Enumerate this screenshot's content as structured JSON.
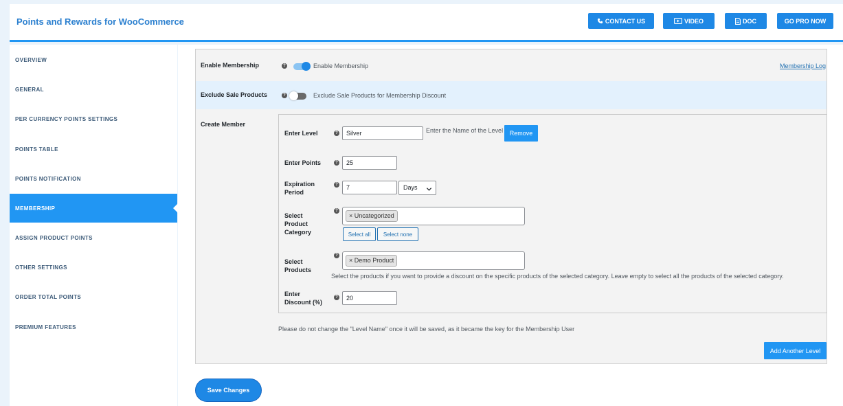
{
  "app": {
    "title": "Points and Rewards for WooCommerce"
  },
  "header_buttons": [
    {
      "label": "CONTACT US",
      "icon": "phone-icon"
    },
    {
      "label": "VIDEO",
      "icon": "play-icon"
    },
    {
      "label": "DOC",
      "icon": "document-icon"
    },
    {
      "label": "GO PRO NOW",
      "icon": ""
    }
  ],
  "sidebar": {
    "items": [
      {
        "label": "OVERVIEW",
        "active": false
      },
      {
        "label": "GENERAL",
        "active": false
      },
      {
        "label": "PER CURRENCY POINTS SETTINGS",
        "active": false
      },
      {
        "label": "POINTS TABLE",
        "active": false
      },
      {
        "label": "POINTS NOTIFICATION",
        "active": false
      },
      {
        "label": "MEMBERSHIP",
        "active": true
      },
      {
        "label": "ASSIGN PRODUCT POINTS",
        "active": false
      },
      {
        "label": "OTHER SETTINGS",
        "active": false
      },
      {
        "label": "ORDER TOTAL POINTS",
        "active": false
      },
      {
        "label": "PREMIUM FEATURES",
        "active": false
      }
    ]
  },
  "settings": {
    "enable_membership": {
      "label": "Enable Membership",
      "toggle_on": true,
      "description": "Enable Membership",
      "log_link": "Membership Log"
    },
    "exclude_sale": {
      "label": "Exclude Sale Products",
      "toggle_on": false,
      "description": "Exclude Sale Products for Membership Discount"
    },
    "create_member": {
      "label": "Create Member",
      "level": {
        "label": "Enter Level",
        "value": "Silver",
        "hint": "Enter the Name of the Level",
        "remove_label": "Remove"
      },
      "points": {
        "label": "Enter Points",
        "value": "25"
      },
      "expiration": {
        "label": "Expiration Period",
        "value": "7",
        "unit": "Days"
      },
      "category": {
        "label": "Select Product Category",
        "chips": [
          "× Uncategorized"
        ],
        "select_all": "Select all",
        "select_none": "Select none"
      },
      "products": {
        "label": "Select Products",
        "chips": [
          "× Demo Product"
        ],
        "hint": "Select the products if you want to provide a discount on the specific products of the selected category. Leave empty to select all the products of the selected category."
      },
      "discount": {
        "label": "Enter Discount (%)",
        "value": "20"
      },
      "notice": "Please do not change the \"Level Name\" once it will be saved, as it became the key for the Membership User",
      "add_level_label": "Add Another Level"
    }
  },
  "save_label": "Save Changes",
  "colors": {
    "accent": "#2196f3",
    "brand_title": "#2a7fcf",
    "band": "#e3f1fd"
  }
}
